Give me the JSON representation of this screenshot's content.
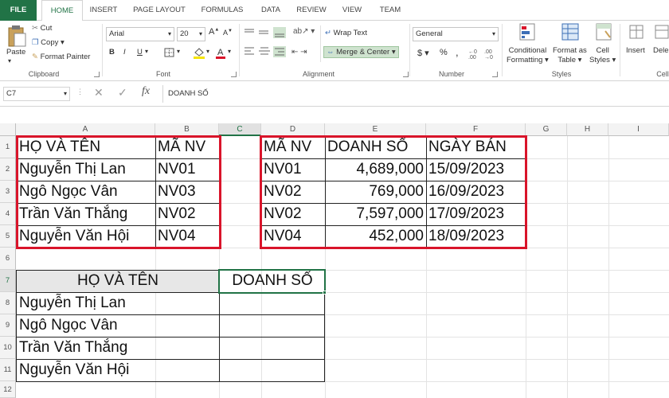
{
  "tabs": [
    "FILE",
    "HOME",
    "INSERT",
    "PAGE LAYOUT",
    "FORMULAS",
    "DATA",
    "REVIEW",
    "VIEW",
    "TEAM"
  ],
  "clipboard": {
    "paste": "Paste",
    "cut": "Cut",
    "copy": "Copy",
    "format_painter": "Format Painter",
    "label": "Clipboard"
  },
  "font": {
    "name": "Arial",
    "size": "20",
    "bold": "B",
    "italic": "I",
    "underline": "U",
    "label": "Font"
  },
  "alignment": {
    "wrap_text": "Wrap Text",
    "merge_center": "Merge & Center",
    "label": "Alignment"
  },
  "number": {
    "format": "General",
    "currency": "$",
    "percent": "%",
    "comma": ",",
    "label": "Number"
  },
  "styles": {
    "conditional": "Conditional",
    "formatting": "Formatting",
    "format_as": "Format as",
    "table": "Table",
    "cell": "Cell",
    "styles": "Styles",
    "label": "Styles"
  },
  "cells": {
    "insert": "Insert",
    "delete": "Dele",
    "label": "Cell"
  },
  "formula_bar": {
    "name_box": "C7",
    "fx": "fx",
    "content": "DOANH SỐ"
  },
  "columns": [
    "A",
    "B",
    "C",
    "D",
    "E",
    "F",
    "G",
    "H",
    "I"
  ],
  "rows": [
    "1",
    "2",
    "3",
    "4",
    "5",
    "6",
    "7",
    "8",
    "9",
    "10",
    "11",
    "12"
  ],
  "table1": {
    "headers": [
      "HỌ VÀ TÊN",
      "MÃ NV"
    ],
    "rows": [
      [
        "Nguyễn Thị Lan",
        "NV01"
      ],
      [
        "Ngô Ngọc Vân",
        "NV03"
      ],
      [
        "Trần Văn Thắng",
        "NV02"
      ],
      [
        "Nguyễn Văn Hội",
        "NV04"
      ]
    ]
  },
  "table2": {
    "headers": [
      "MÃ NV",
      "DOANH SỐ",
      "NGÀY BÁN"
    ],
    "rows": [
      [
        "NV01",
        "4,689,000",
        "15/09/2023"
      ],
      [
        "NV02",
        "769,000",
        "16/09/2023"
      ],
      [
        "NV02",
        "7,597,000",
        "17/09/2023"
      ],
      [
        "NV04",
        "452,000",
        "18/09/2023"
      ]
    ]
  },
  "table3": {
    "headers": [
      "HỌ VÀ TÊN",
      "DOANH SỐ"
    ],
    "names": [
      "Nguyễn Thị Lan",
      "Ngô Ngọc Vân",
      "Trần Văn Thắng",
      "Nguyễn Văn Hội"
    ]
  }
}
